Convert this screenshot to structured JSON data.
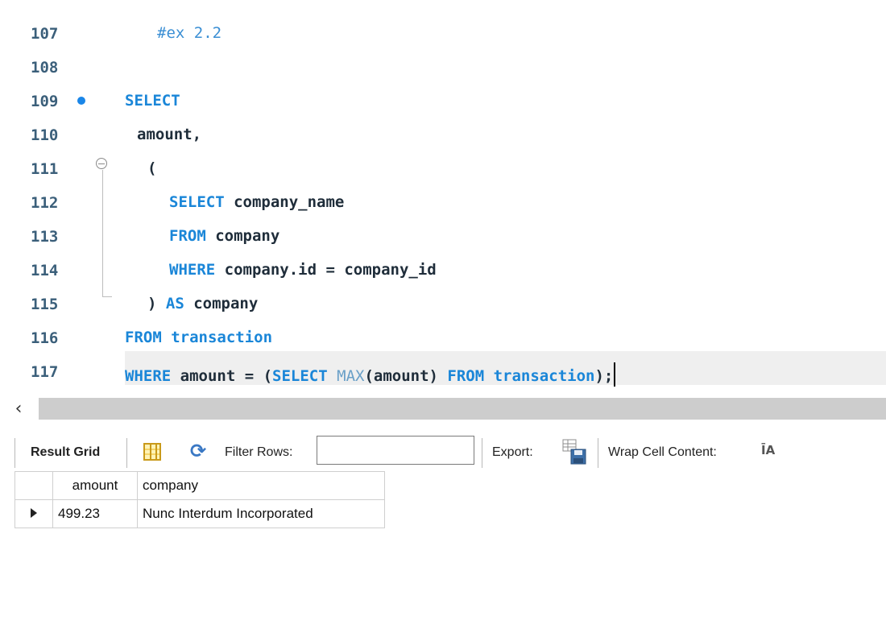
{
  "editor": {
    "lines": [
      {
        "num": "107",
        "parts": [
          {
            "t": "#ex 2.2",
            "c": "cm"
          }
        ]
      },
      {
        "num": "108",
        "parts": []
      },
      {
        "num": "109",
        "parts": [
          {
            "t": "SELECT",
            "c": "kw"
          }
        ],
        "breakpoint": true
      },
      {
        "num": "110",
        "parts": [
          {
            "t": "amount,",
            "c": ""
          }
        ]
      },
      {
        "num": "111",
        "parts": [
          {
            "t": "(",
            "c": ""
          }
        ]
      },
      {
        "num": "112",
        "parts": [
          {
            "t": "SELECT",
            "c": "kw"
          },
          {
            "t": " company_name",
            "c": ""
          }
        ]
      },
      {
        "num": "113",
        "parts": [
          {
            "t": "FROM",
            "c": "kw"
          },
          {
            "t": " company",
            "c": ""
          }
        ]
      },
      {
        "num": "114",
        "parts": [
          {
            "t": "WHERE",
            "c": "kw"
          },
          {
            "t": " company.id = company_id",
            "c": ""
          }
        ]
      },
      {
        "num": "115",
        "parts": [
          {
            "t": ") ",
            "c": ""
          },
          {
            "t": "AS",
            "c": "kw"
          },
          {
            "t": " company",
            "c": ""
          }
        ]
      },
      {
        "num": "116",
        "parts": [
          {
            "t": "FROM transaction",
            "c": "kw"
          }
        ]
      },
      {
        "num": "117",
        "parts": [
          {
            "t": "WHERE",
            "c": "kw"
          },
          {
            "t": " amount = (",
            "c": ""
          },
          {
            "t": "SELECT",
            "c": "kw"
          },
          {
            "t": " ",
            "c": ""
          },
          {
            "t": "MAX",
            "c": "fn"
          },
          {
            "t": "(amount) ",
            "c": ""
          },
          {
            "t": "FROM transaction",
            "c": "kw"
          },
          {
            "t": ");",
            "c": ""
          }
        ],
        "current": true
      }
    ]
  },
  "scrollbar": {
    "left_arrow": "‹"
  },
  "toolbar": {
    "result_grid_label": "Result Grid",
    "filter_rows_label": "Filter Rows:",
    "filter_value": "",
    "export_label": "Export:",
    "wrap_label": "Wrap Cell Content:",
    "wrap_icon_glyph": "ĪA",
    "refresh_glyph": "⟳"
  },
  "grid": {
    "columns": [
      "amount",
      "company"
    ],
    "rows": [
      {
        "amount": "499.23",
        "company": "Nunc Interdum Incorporated"
      }
    ]
  },
  "colors": {
    "keyword": "#1a86d8",
    "function": "#6aa0c8",
    "breakpoint": "#1a86e8",
    "line_number": "#3b5f7a"
  },
  "icons": [
    "breakpoint-dot-icon",
    "fold-collapse-icon",
    "grid-layout-icon",
    "refresh-icon",
    "export-icon",
    "wrap-cell-icon",
    "row-pointer-icon"
  ]
}
